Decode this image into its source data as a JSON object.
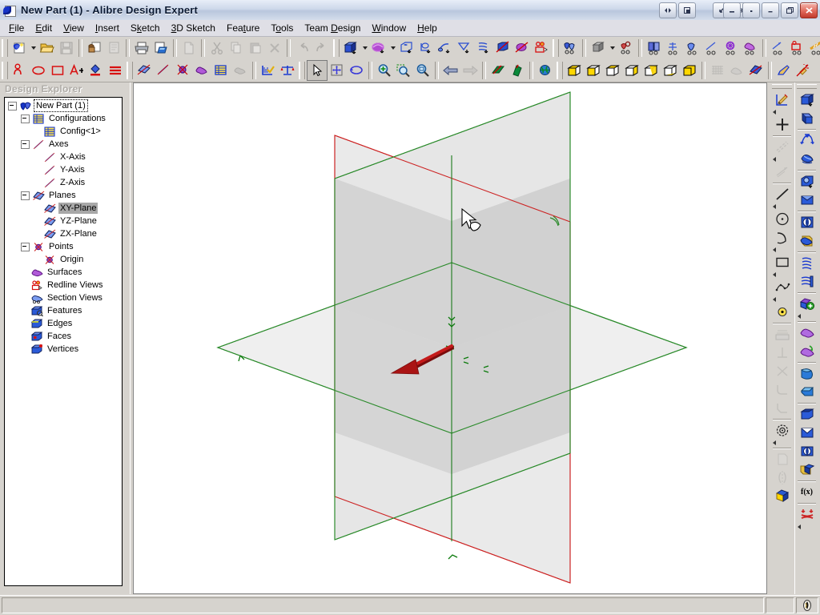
{
  "window": {
    "title": "New Part (1) - Alibre Design Expert",
    "app_icon": "alibre-logo-icon",
    "controls": {
      "mdi_restore": "mdi-restore-button",
      "mdi_minimize": "mdi-minimize-button",
      "undo_arrow": "undo-arrow-button",
      "redo_arrow": "redo-arrow-button",
      "minimize": "minimize-button",
      "small": "small-button",
      "restore_down": "restore-down-button",
      "maximize": "maximize-button",
      "close": "close-button"
    }
  },
  "menubar": {
    "items": [
      {
        "label": "File",
        "accel": "F"
      },
      {
        "label": "Edit",
        "accel": "E"
      },
      {
        "label": "View",
        "accel": "V"
      },
      {
        "label": "Insert",
        "accel": "I"
      },
      {
        "label": "Sketch",
        "accel": "k"
      },
      {
        "label": "3D Sketch",
        "accel": "3"
      },
      {
        "label": "Feature",
        "accel": "t"
      },
      {
        "label": "Tools",
        "accel": "o"
      },
      {
        "label": "Team Design",
        "accel": "D"
      },
      {
        "label": "Window",
        "accel": "W"
      },
      {
        "label": "Help",
        "accel": "H"
      }
    ]
  },
  "toolbar_main": {
    "groups": [
      {
        "items": [
          {
            "name": "new-part-button",
            "title": "New",
            "enabled": true,
            "dropdown": true
          },
          {
            "name": "open-button",
            "title": "Open",
            "enabled": true
          },
          {
            "name": "save-button",
            "title": "Save",
            "enabled": false
          }
        ]
      },
      {
        "items": [
          {
            "name": "checkin-button",
            "title": "Check In",
            "enabled": true
          },
          {
            "name": "checkout-button",
            "title": "Check Out",
            "enabled": false
          }
        ]
      },
      {
        "items": [
          {
            "name": "print-button",
            "title": "Print",
            "enabled": true
          },
          {
            "name": "print-preview-button",
            "title": "Print Preview",
            "enabled": true
          }
        ]
      },
      {
        "items": [
          {
            "name": "new-document-button",
            "title": "New Document",
            "enabled": false
          }
        ]
      },
      {
        "items": [
          {
            "name": "cut-button",
            "title": "Cut",
            "enabled": false
          },
          {
            "name": "copy-button",
            "title": "Copy",
            "enabled": false
          },
          {
            "name": "paste-button",
            "title": "Paste",
            "enabled": false
          },
          {
            "name": "delete-button",
            "title": "Delete",
            "enabled": false
          }
        ]
      },
      {
        "items": [
          {
            "name": "undo-button",
            "title": "Undo",
            "enabled": false
          },
          {
            "name": "redo-button",
            "title": "Redo",
            "enabled": false
          }
        ]
      },
      {
        "items": [
          {
            "name": "extrude-boss-button",
            "title": "Extrude Boss",
            "enabled": true,
            "dropdown": true
          },
          {
            "name": "revolve-boss-button",
            "title": "Revolve Boss",
            "enabled": true,
            "dropdown": true
          },
          {
            "name": "extrude-cut-button",
            "title": "Extrude Cut",
            "enabled": true
          },
          {
            "name": "revolve-cut-button",
            "title": "Revolve Cut",
            "enabled": true
          },
          {
            "name": "sweep-button",
            "title": "Sweep",
            "enabled": true
          },
          {
            "name": "loft-button",
            "title": "Loft",
            "enabled": true
          },
          {
            "name": "helix-button",
            "title": "Helix",
            "enabled": true
          },
          {
            "name": "shell-button",
            "title": "Shell",
            "enabled": true
          },
          {
            "name": "draft-button",
            "title": "Draft",
            "enabled": true
          },
          {
            "name": "redline-button",
            "title": "Redline",
            "enabled": true
          }
        ]
      },
      {
        "items": [
          {
            "name": "assembly-insert-button",
            "title": "Insert Part",
            "enabled": true
          }
        ]
      },
      {
        "items": [
          {
            "name": "part-color-button",
            "title": "Part Color",
            "enabled": true,
            "dropdown": true
          },
          {
            "name": "constraint-button",
            "title": "Constraint",
            "enabled": true
          }
        ]
      },
      {
        "items": [
          {
            "name": "align-button",
            "title": "Align",
            "enabled": true
          },
          {
            "name": "mate-button",
            "title": "Mate",
            "enabled": true
          },
          {
            "name": "insert-button",
            "title": "Insert",
            "enabled": true
          },
          {
            "name": "tangent-button",
            "title": "Tangent",
            "enabled": true
          },
          {
            "name": "gear-constraint-button",
            "title": "Gear",
            "enabled": true
          },
          {
            "name": "cam-constraint-button",
            "title": "Cam",
            "enabled": true
          }
        ]
      },
      {
        "items": [
          {
            "name": "motion-button",
            "title": "Motion",
            "enabled": true
          },
          {
            "name": "interference-button",
            "title": "Interference",
            "enabled": true
          },
          {
            "name": "explode-button",
            "title": "Explode",
            "enabled": true
          }
        ]
      },
      {
        "items": [
          {
            "name": "pattern-button",
            "title": "Pattern",
            "enabled": true
          },
          {
            "name": "mirror-button",
            "title": "Mirror",
            "enabled": true
          }
        ]
      }
    ]
  },
  "toolbar_sketch": {
    "groups": [
      {
        "items": [
          {
            "name": "sketch-figure-button",
            "title": "Figure",
            "enabled": true
          },
          {
            "name": "ellipse-button",
            "title": "Ellipse",
            "enabled": true
          },
          {
            "name": "rectangle-button",
            "title": "Rectangle",
            "enabled": true
          },
          {
            "name": "text-button",
            "title": "Text",
            "enabled": true
          },
          {
            "name": "fill-button",
            "title": "Fill",
            "enabled": true
          },
          {
            "name": "lines-button",
            "title": "Lines",
            "enabled": true
          }
        ]
      },
      {
        "items": [
          {
            "name": "plane-select-button",
            "title": "Plane",
            "enabled": true
          },
          {
            "name": "axis-select-button",
            "title": "Axis",
            "enabled": true
          },
          {
            "name": "point-select-button",
            "title": "Point",
            "enabled": true
          },
          {
            "name": "surface-select-button",
            "title": "Surface",
            "enabled": true
          },
          {
            "name": "config-table-button",
            "title": "Configurations",
            "enabled": true
          },
          {
            "name": "material-button",
            "title": "Material",
            "enabled": false
          }
        ]
      },
      {
        "items": [
          {
            "name": "measure-button",
            "title": "Measure",
            "enabled": true
          },
          {
            "name": "physical-props-button",
            "title": "Physical Properties",
            "enabled": true
          }
        ]
      },
      {
        "items": [
          {
            "name": "select-tool-button",
            "title": "Select",
            "enabled": true,
            "pressed": true
          },
          {
            "name": "pan-tool-button",
            "title": "Pan",
            "enabled": true
          },
          {
            "name": "rotate-tool-button",
            "title": "Rotate",
            "enabled": true
          }
        ]
      },
      {
        "items": [
          {
            "name": "zoom-in-button",
            "title": "Zoom In",
            "enabled": true
          },
          {
            "name": "zoom-window-button",
            "title": "Zoom Window",
            "enabled": true
          },
          {
            "name": "zoom-fit-button",
            "title": "Zoom To Fit",
            "enabled": true
          }
        ]
      },
      {
        "items": [
          {
            "name": "previous-view-button",
            "title": "Previous View",
            "enabled": true
          },
          {
            "name": "next-view-button",
            "title": "Next View",
            "enabled": false
          }
        ]
      },
      {
        "items": [
          {
            "name": "normal-to-button",
            "title": "Normal To",
            "enabled": true
          },
          {
            "name": "view-plane-button",
            "title": "View Plane",
            "enabled": true
          }
        ]
      },
      {
        "items": [
          {
            "name": "globe-view-button",
            "title": "Global View",
            "enabled": true
          }
        ]
      },
      {
        "items": [
          {
            "name": "view-iso-button",
            "title": "Isometric View",
            "enabled": true
          },
          {
            "name": "view-front-button",
            "title": "Front View",
            "enabled": true
          },
          {
            "name": "view-top-button",
            "title": "Top View",
            "enabled": true
          },
          {
            "name": "view-right-button",
            "title": "Right View",
            "enabled": true
          },
          {
            "name": "view-back-button",
            "title": "Back View",
            "enabled": true
          },
          {
            "name": "view-bottom-button",
            "title": "Bottom View",
            "enabled": true
          },
          {
            "name": "view-left-button",
            "title": "Left View",
            "enabled": true
          }
        ]
      },
      {
        "items": [
          {
            "name": "wireframe-button",
            "title": "Wireframe",
            "enabled": false
          },
          {
            "name": "hidden-line-button",
            "title": "Hidden Line",
            "enabled": false
          },
          {
            "name": "shaded-button",
            "title": "Shaded",
            "enabled": true
          }
        ]
      },
      {
        "items": [
          {
            "name": "render-button",
            "title": "Render",
            "enabled": true
          },
          {
            "name": "lighting-button",
            "title": "Lighting",
            "enabled": true
          }
        ]
      }
    ]
  },
  "explorer": {
    "title": "Design Explorer",
    "tree": [
      {
        "label": "New Part (1)",
        "icon": "part-icon",
        "depth": 0,
        "expander": "minus",
        "focused": true
      },
      {
        "label": "Configurations",
        "icon": "table-icon",
        "depth": 1,
        "expander": "minus"
      },
      {
        "label": "Config<1>",
        "icon": "table-icon",
        "depth": 2,
        "expander": "none"
      },
      {
        "label": "Axes",
        "icon": "axis-icon",
        "depth": 1,
        "expander": "minus"
      },
      {
        "label": "X-Axis",
        "icon": "axis-icon",
        "depth": 2,
        "expander": "none"
      },
      {
        "label": "Y-Axis",
        "icon": "axis-icon",
        "depth": 2,
        "expander": "none"
      },
      {
        "label": "Z-Axis",
        "icon": "axis-icon",
        "depth": 2,
        "expander": "none"
      },
      {
        "label": "Planes",
        "icon": "plane-icon",
        "depth": 1,
        "expander": "minus"
      },
      {
        "label": "XY-Plane",
        "icon": "plane-icon",
        "depth": 2,
        "expander": "none",
        "selected": true
      },
      {
        "label": "YZ-Plane",
        "icon": "plane-icon",
        "depth": 2,
        "expander": "none"
      },
      {
        "label": "ZX-Plane",
        "icon": "plane-icon",
        "depth": 2,
        "expander": "none"
      },
      {
        "label": "Points",
        "icon": "point-icon",
        "depth": 1,
        "expander": "minus"
      },
      {
        "label": "Origin",
        "icon": "point-icon",
        "depth": 2,
        "expander": "none"
      },
      {
        "label": "Surfaces",
        "icon": "surfaces-icon",
        "depth": 1,
        "expander": "none"
      },
      {
        "label": "Redline Views",
        "icon": "redline-icon",
        "depth": 1,
        "expander": "none"
      },
      {
        "label": "Section Views",
        "icon": "section-icon",
        "depth": 1,
        "expander": "none"
      },
      {
        "label": "Features",
        "icon": "features-icon",
        "depth": 1,
        "expander": "none"
      },
      {
        "label": "Edges",
        "icon": "edges-icon",
        "depth": 1,
        "expander": "none"
      },
      {
        "label": "Faces",
        "icon": "faces-icon",
        "depth": 1,
        "expander": "none"
      },
      {
        "label": "Vertices",
        "icon": "vertices-icon",
        "depth": 1,
        "expander": "none"
      }
    ]
  },
  "viewport": {
    "name": "3d-viewport",
    "background": "#ffffff",
    "planes": [
      {
        "name": "xy-plane-geometry",
        "edge_color": "#008000",
        "fill": "#c8c8c8"
      },
      {
        "name": "yz-plane-geometry",
        "edge_color": "#cc0000",
        "fill": "#e8e8e8"
      },
      {
        "name": "zx-plane-geometry",
        "edge_color": "#008000",
        "fill": "#eeeeee"
      }
    ],
    "origin_marker": {
      "name": "origin-triad",
      "color": "#008000"
    },
    "normal_arrow": {
      "name": "plane-normal-arrow",
      "color": "#b01010"
    },
    "cursor": {
      "name": "select-plane-cursor"
    }
  },
  "right_toolbar": {
    "column_sketch": [
      {
        "name": "sketch-mode-button",
        "title": "Activate 2D Sketch",
        "enabled": true,
        "flyout": true
      },
      {
        "name": "sketch-point-button",
        "title": "Sketch Point",
        "enabled": true
      },
      {
        "name": "reference-line-button",
        "title": "Reference Line",
        "enabled": false,
        "flyout": true
      },
      {
        "name": "connected-lines-button",
        "title": "Connected Lines",
        "enabled": false
      },
      {
        "name": "line-button",
        "title": "Line",
        "enabled": true,
        "flyout": true
      },
      {
        "name": "circle-button",
        "title": "Circle",
        "enabled": true
      },
      {
        "name": "arc-button",
        "title": "Arc",
        "enabled": true,
        "flyout": true
      },
      {
        "name": "rectangle-button",
        "title": "Rectangle",
        "enabled": true,
        "flyout": true
      },
      {
        "name": "spline-button",
        "title": "Spline",
        "enabled": true,
        "flyout": true
      },
      {
        "name": "point-button",
        "title": "Point",
        "enabled": true
      },
      {
        "name": "dimension-button",
        "title": "Dimension",
        "enabled": false
      },
      {
        "name": "perpendicular-button",
        "title": "Perpendicular",
        "enabled": false
      },
      {
        "name": "intersect-button",
        "title": "Intersection",
        "enabled": false
      },
      {
        "name": "fillet-button",
        "title": "Fillet",
        "enabled": false
      },
      {
        "name": "chamfer-button",
        "title": "Chamfer",
        "enabled": false
      },
      {
        "name": "offset-button",
        "title": "Offset",
        "enabled": true,
        "flyout": true
      },
      {
        "name": "project-button",
        "title": "Project to Sketch",
        "enabled": false
      },
      {
        "name": "mirror-sketch-button",
        "title": "Mirror Sketch",
        "enabled": false
      },
      {
        "name": "sketch-fill-button",
        "title": "Sketch Fill",
        "enabled": true
      }
    ],
    "column_feature": [
      {
        "name": "extrude-boss-button",
        "title": "Extrude Boss",
        "enabled": true
      },
      {
        "name": "revolve-boss-button",
        "title": "Revolve Boss",
        "enabled": true
      },
      {
        "name": "sweep-boss-button",
        "title": "Sweep Boss",
        "enabled": true
      },
      {
        "name": "loft-boss-button",
        "title": "Loft Boss",
        "enabled": true
      },
      {
        "name": "extrude-cut-button",
        "title": "Extrude Cut",
        "enabled": true
      },
      {
        "name": "revolve-cut-button",
        "title": "Revolve Cut",
        "enabled": true
      },
      {
        "name": "sweep-cut-button",
        "title": "Sweep Cut",
        "enabled": true
      },
      {
        "name": "loft-cut-button",
        "title": "Loft Cut",
        "enabled": true
      },
      {
        "name": "helix-boss-button",
        "title": "Helical Boss",
        "enabled": true
      },
      {
        "name": "helix-cut-button",
        "title": "Helical Cut",
        "enabled": true
      },
      {
        "name": "add-feature-button",
        "title": "Add Feature",
        "enabled": true,
        "flyout": true
      },
      {
        "name": "surface-feature-button",
        "title": "Surface",
        "enabled": true
      },
      {
        "name": "loft-surface-button",
        "title": "Loft Surface",
        "enabled": true
      },
      {
        "name": "fillet-feature-button",
        "title": "Fillet",
        "enabled": true
      },
      {
        "name": "chamfer-feature-button",
        "title": "Chamfer",
        "enabled": true
      },
      {
        "name": "shell-feature-button",
        "title": "Shell",
        "enabled": true
      },
      {
        "name": "draft-feature-button",
        "title": "Draft",
        "enabled": true
      },
      {
        "name": "hole-feature-button",
        "title": "Hole",
        "enabled": true
      },
      {
        "name": "thread-feature-button",
        "title": "Thread",
        "enabled": true
      },
      {
        "name": "equation-button",
        "title": "Equation Editor",
        "enabled": true,
        "label": "f(x)"
      },
      {
        "name": "datum-button",
        "title": "Datum",
        "enabled": true,
        "flyout": true
      }
    ]
  },
  "statusbar": {
    "message": "",
    "pane1": "",
    "logo": "alibre-status-logo"
  }
}
